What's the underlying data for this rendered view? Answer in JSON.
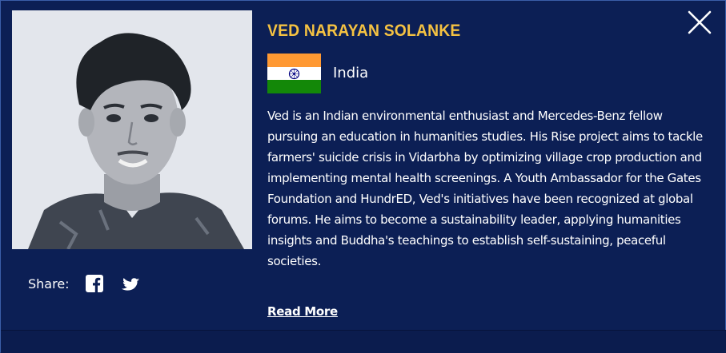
{
  "profile": {
    "name": "VED NARAYAN SOLANKE",
    "country": "India",
    "bio": "Ved is an Indian environmental enthusiast and Mercedes-Benz fellow pursuing an education in humanities studies. His Rise project aims to tackle farmers' suicide crisis in Vidarbha by optimizing village crop production and implementing mental health screenings. A Youth Ambassador for the Gates Foundation and HundrED, Ved's initiatives have been recognized at global forums. He aims to become a sustainability leader, applying humanities insights and Buddha's teachings to establish self-sustaining, peaceful societies.",
    "read_more_label": "Read More"
  },
  "share": {
    "label": "Share:",
    "icons": [
      "facebook-icon",
      "twitter-icon"
    ]
  },
  "flag": {
    "colors": [
      "#ff9933",
      "#ffffff",
      "#138808"
    ],
    "chakra_color": "#000080"
  },
  "colors": {
    "background": "#0c1f55",
    "name": "#f5c242",
    "text": "#ffffff"
  },
  "controls": {
    "close_icon": "close-icon"
  }
}
